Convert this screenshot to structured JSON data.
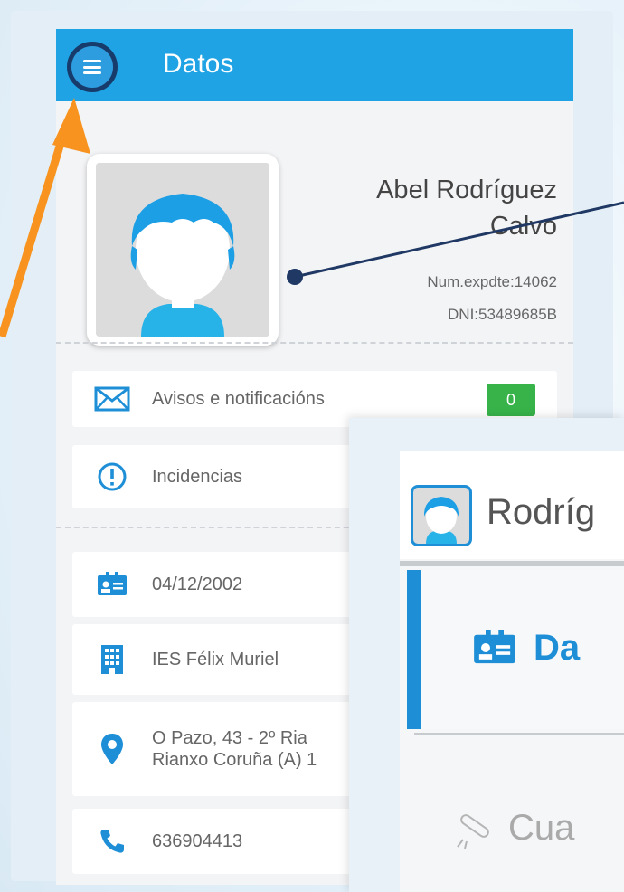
{
  "appbar": {
    "title": "Datos"
  },
  "profile": {
    "name_line1": "Abel Rodríguez",
    "name_line2": "Calvo",
    "file_number": "Num.expdte:14062",
    "dni": "DNI:53489685B"
  },
  "notifications": {
    "items": [
      {
        "label": "Avisos e notificacións",
        "icon": "envelope-icon",
        "badge": "0"
      },
      {
        "label": "Incidencias",
        "icon": "exclamation-circle-icon"
      }
    ]
  },
  "details": {
    "items": [
      {
        "label": "04/12/2002",
        "icon": "id-card-icon"
      },
      {
        "label": "IES Félix Muriel",
        "icon": "building-icon"
      },
      {
        "line1": "O Pazo, 43 - 2º Ria",
        "line2": "Rianxo Coruña (A) 1",
        "icon": "location-pin-icon"
      },
      {
        "label": "636904413",
        "icon": "phone-icon"
      }
    ]
  },
  "popup": {
    "name": "Rodríg",
    "active_item": "Da",
    "second_item": "Cua"
  },
  "colors": {
    "appbar": "#1fa3e4",
    "highlight_ring": "#173c6b",
    "arrow": "#f7931e",
    "badge": "#37b34a",
    "icon_blue": "#1e8fd6"
  }
}
